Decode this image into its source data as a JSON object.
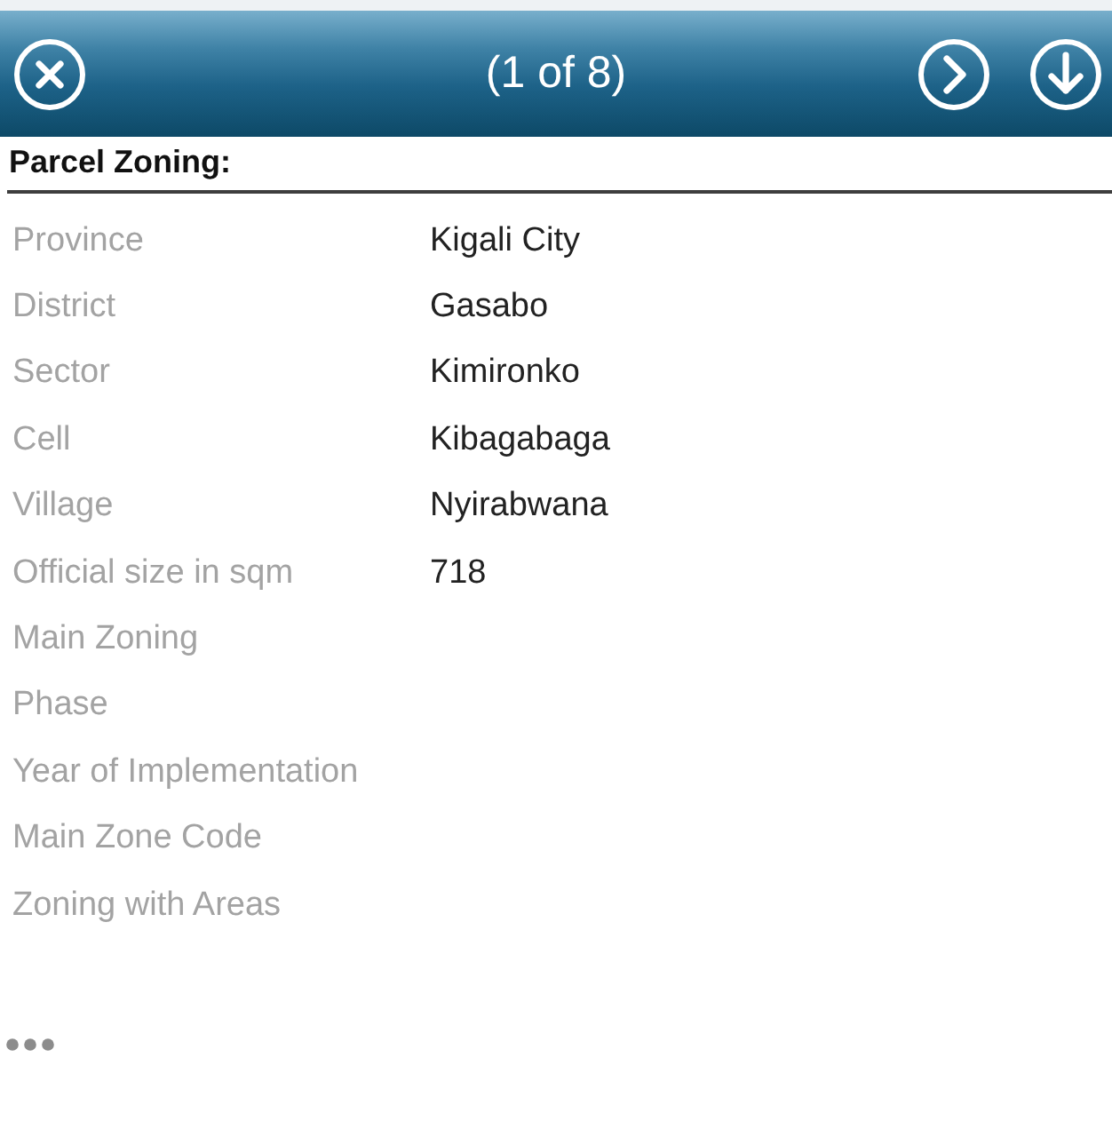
{
  "header": {
    "title": "(1 of 8)"
  },
  "section": {
    "title": "Parcel Zoning:"
  },
  "fields": [
    {
      "label": "Province",
      "value": "Kigali City"
    },
    {
      "label": "District",
      "value": "Gasabo"
    },
    {
      "label": "Sector",
      "value": "Kimironko"
    },
    {
      "label": "Cell",
      "value": "Kibagabaga"
    },
    {
      "label": "Village",
      "value": "Nyirabwana"
    },
    {
      "label": "Official size in sqm",
      "value": "718"
    },
    {
      "label": "Main Zoning"
    },
    {
      "label": "Phase"
    },
    {
      "label": "Year of Implementation"
    },
    {
      "label": "Main Zone Code"
    },
    {
      "label": "Zoning with Areas"
    }
  ]
}
